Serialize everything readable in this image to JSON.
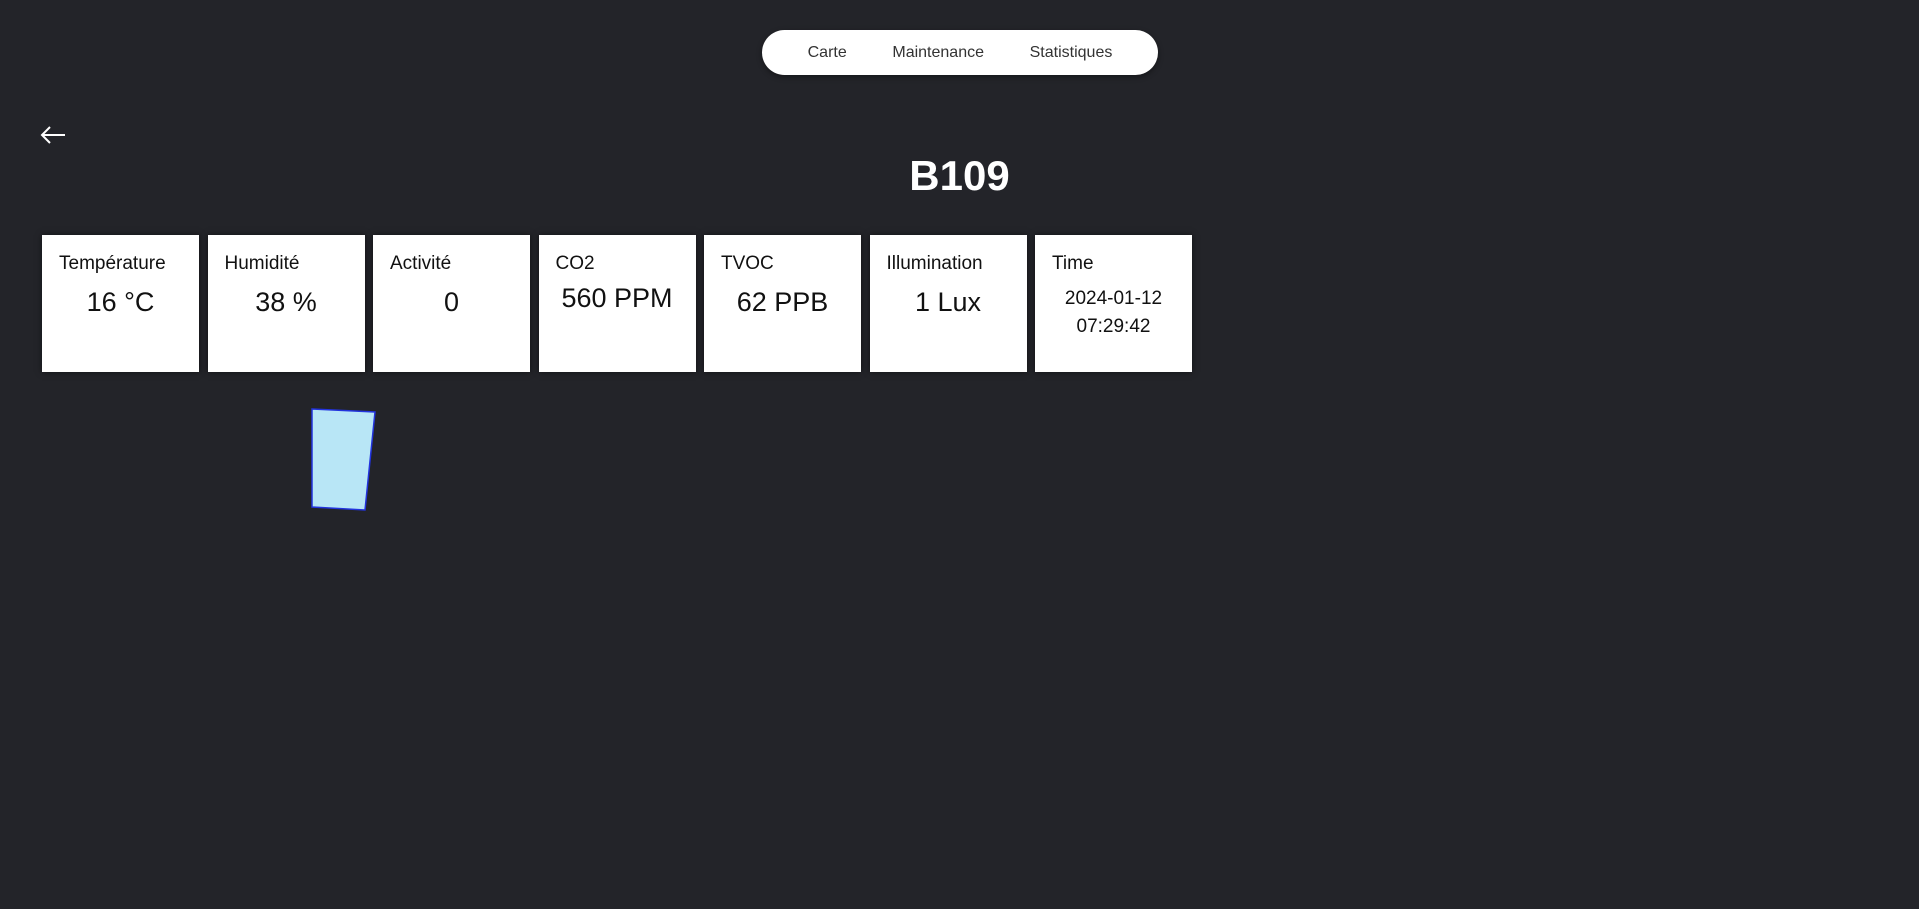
{
  "nav": {
    "items": [
      "Carte",
      "Maintenance",
      "Statistiques"
    ]
  },
  "back": {
    "icon": "arrow-left-icon"
  },
  "room": {
    "title": "B109"
  },
  "metrics": [
    {
      "label": "Température",
      "value": "16 °C"
    },
    {
      "label": "Humidité",
      "value": "38 %"
    },
    {
      "label": "Activité",
      "value": "0"
    },
    {
      "label": "CO2",
      "value": "560 PPM"
    },
    {
      "label": "TVOC",
      "value": "62 PPB"
    },
    {
      "label": "Illumination",
      "value": "1 Lux"
    },
    {
      "label": "Time",
      "date": "2024-01-12",
      "time": "07:29:42"
    }
  ],
  "colors": {
    "background": "#232429",
    "room_shape_fill": "#b8e6f6",
    "room_shape_stroke": "#2233dd"
  }
}
